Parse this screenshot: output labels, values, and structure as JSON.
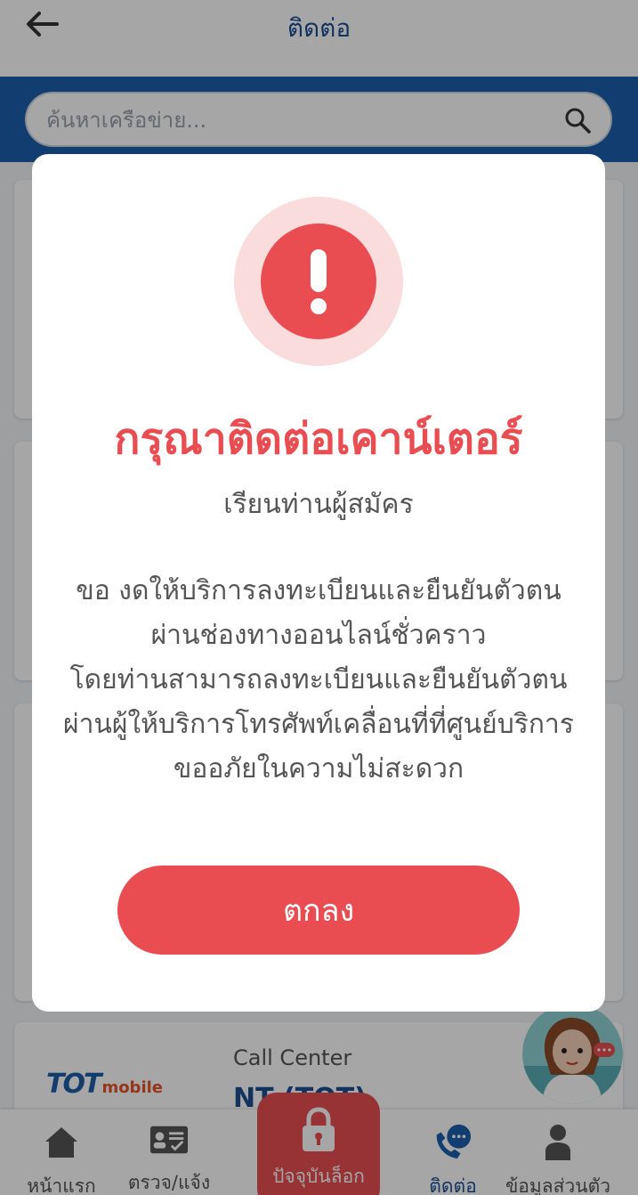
{
  "header": {
    "title": "ติดต่อ"
  },
  "search": {
    "placeholder": "ค้นหาเครือข่าย..."
  },
  "visible_card": {
    "label": "Call Center",
    "name": "NT (TOT)",
    "logo_text_main": "TOT",
    "logo_text_sub": "mobile"
  },
  "bottom_nav": {
    "home": "หน้าแรก",
    "check": "ตรวจ/แจ้ง",
    "lock": "ปัจจุบันล็อก",
    "contact": "ติดต่อ",
    "profile": "ข้อมูลส่วนตัว"
  },
  "dialog": {
    "title": "กรุณาติดต่อเคาน์เตอร์",
    "subtitle": "เรียนท่านผู้สมัคร",
    "body_lines": [
      "ขอ งดให้บริการลงทะเบียนและยืนยันตัวตน",
      "ผ่านช่องทางออนไลน์ชั่วคราว",
      "โดยท่านสามารถลงทะเบียนและยืนยันตัวตน",
      "ผ่านผู้ให้บริการโทรศัพท์เคลื่อนที่ที่ศูนย์บริการ",
      "ขออภัยในความไม่สะดวก"
    ],
    "ok_label": "ตกลง"
  },
  "colors": {
    "primary": "#1d5fae",
    "accent": "#e94d52",
    "accent_light": "#fbdcdd"
  }
}
